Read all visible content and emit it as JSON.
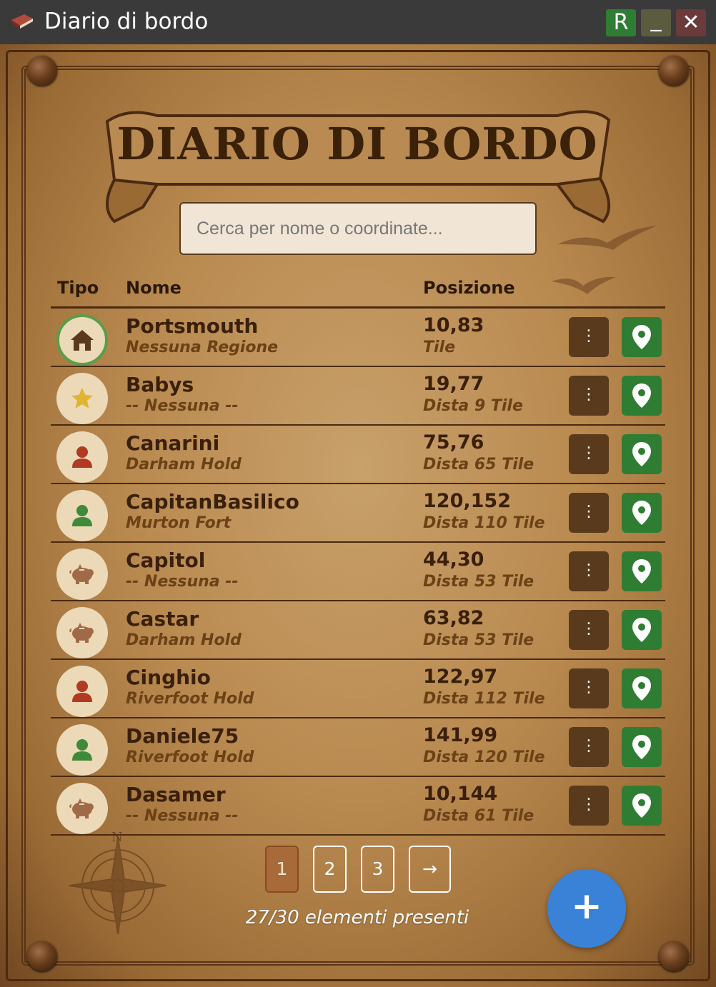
{
  "window": {
    "title": "Diario di bordo",
    "buttons": {
      "r": "R",
      "minimize": "_",
      "close": "✕"
    }
  },
  "header": {
    "banner_title": "DIARIO DI BORDO"
  },
  "search": {
    "placeholder": "Cerca per nome o coordinate...",
    "value": ""
  },
  "table": {
    "columns": {
      "type": "Tipo",
      "name": "Nome",
      "position": "Posizione"
    },
    "rows": [
      {
        "type": "home-icon",
        "name": "Portsmouth",
        "region": "Nessuna Regione",
        "coords": "10,83",
        "distance": "Tile"
      },
      {
        "type": "star-icon",
        "name": "Babys",
        "region": "-- Nessuna --",
        "coords": "19,77",
        "distance": "Dista 9 Tile"
      },
      {
        "type": "person-red-icon",
        "name": "Canarini",
        "region": "Darham Hold",
        "coords": "75,76",
        "distance": "Dista 65 Tile"
      },
      {
        "type": "person-green-icon",
        "name": "CapitanBasilico",
        "region": "Murton Fort",
        "coords": "120,152",
        "distance": "Dista 110 Tile"
      },
      {
        "type": "piggy-bank-icon",
        "name": "Capitol",
        "region": "-- Nessuna --",
        "coords": "44,30",
        "distance": "Dista 53 Tile"
      },
      {
        "type": "piggy-bank-icon",
        "name": "Castar",
        "region": "Darham Hold",
        "coords": "63,82",
        "distance": "Dista 53 Tile"
      },
      {
        "type": "person-red-icon",
        "name": "Cinghio",
        "region": "Riverfoot Hold",
        "coords": "122,97",
        "distance": "Dista 112 Tile"
      },
      {
        "type": "person-green-icon",
        "name": "Daniele75",
        "region": "Riverfoot Hold",
        "coords": "141,99",
        "distance": "Dista 120 Tile"
      },
      {
        "type": "piggy-bank-icon",
        "name": "Dasamer",
        "region": "-- Nessuna --",
        "coords": "10,144",
        "distance": "Dista 61 Tile"
      }
    ],
    "row_menu_label": "⋮"
  },
  "pagination": {
    "pages": [
      "1",
      "2",
      "3"
    ],
    "current": "1",
    "next_label": "→",
    "count_text": "27/30 elementi presenti"
  },
  "fab": {
    "label": "+"
  },
  "colors": {
    "title_bar": "#3a3a3a",
    "accent_green": "#2e7d32",
    "menu_brown": "#5a3a1c",
    "fab_blue": "#3a82d8",
    "text_dark": "#3a200a",
    "text_region": "#6b4116",
    "person_red": "#b03a22",
    "person_green": "#3f8a3a",
    "star_gold": "#e0b432"
  }
}
